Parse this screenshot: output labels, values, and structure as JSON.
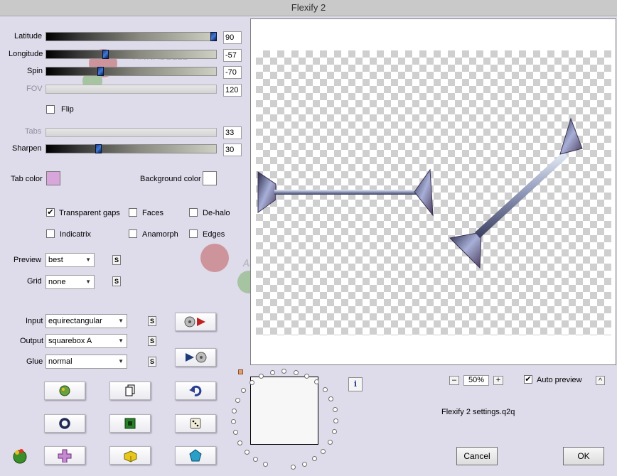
{
  "window": {
    "title": "Flexify 2"
  },
  "sliders": [
    {
      "label": "Latitude",
      "value": "90",
      "fraction": 1.0,
      "enabled": true
    },
    {
      "label": "Longitude",
      "value": "-57",
      "fraction": 0.34,
      "enabled": true
    },
    {
      "label": "Spin",
      "value": "-70",
      "fraction": 0.31,
      "enabled": true
    },
    {
      "label": "FOV",
      "value": "120",
      "fraction": 0.0,
      "enabled": false
    }
  ],
  "flip": {
    "label": "Flip",
    "checked": false
  },
  "tabs": {
    "label": "Tabs",
    "value": "33",
    "enabled": false
  },
  "sharpen": {
    "label": "Sharpen",
    "value": "30",
    "fraction": 0.3
  },
  "colors": {
    "tab_color_label": "Tab color",
    "tab_color": "#d9a6dc",
    "background_color_label": "Background color",
    "background_color": "#ffffff"
  },
  "options": {
    "transparent_gaps": {
      "label": "Transparent gaps",
      "checked": true
    },
    "faces": {
      "label": "Faces",
      "checked": false
    },
    "de_halo": {
      "label": "De-halo",
      "checked": false
    },
    "indicatrix": {
      "label": "Indicatrix",
      "checked": false
    },
    "anamorph": {
      "label": "Anamorph",
      "checked": false
    },
    "edges": {
      "label": "Edges",
      "checked": false
    }
  },
  "preview_select": {
    "label": "Preview",
    "value": "best"
  },
  "grid_select": {
    "label": "Grid",
    "value": "none"
  },
  "input_select": {
    "label": "Input",
    "value": "equirectangular"
  },
  "output_select": {
    "label": "Output",
    "value": "squarebox A"
  },
  "glue_select": {
    "label": "Glue",
    "value": "normal"
  },
  "s_button_label": "S",
  "zoom": {
    "minus": "–",
    "value": "50%",
    "plus": "+"
  },
  "auto_preview": {
    "label": "Auto preview",
    "checked": true,
    "collapse": "^"
  },
  "settings_file": "Flexify 2 settings.q2q",
  "info_button": "i",
  "buttons": {
    "cancel": "Cancel",
    "ok": "OK"
  },
  "watermark_text": "ANNABELLE",
  "accent": "#2f5db8"
}
